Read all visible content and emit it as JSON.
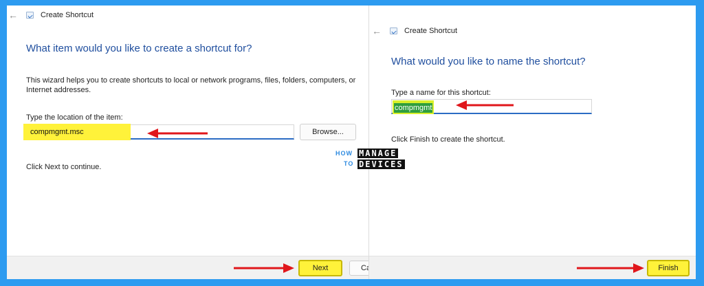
{
  "left_wizard": {
    "title": "Create Shortcut",
    "heading": "What item would you like to create a shortcut for?",
    "description": "This wizard helps you to create shortcuts to local or network programs, files, folders, computers, or Internet addresses.",
    "location_label": "Type the location of the item:",
    "location_value": "compmgmt.msc",
    "browse_label": "Browse...",
    "continue_text": "Click Next to continue.",
    "next_label": "Next",
    "cancel_label": "Ca"
  },
  "right_wizard": {
    "title": "Create Shortcut",
    "heading": "What would you like to name the shortcut?",
    "name_label": "Type a name for this shortcut:",
    "name_value": "compmgmt",
    "finish_text": "Click Finish to create the shortcut.",
    "finish_label": "Finish"
  },
  "logo": {
    "how": "HOW",
    "to": "TO",
    "manage": "MANAGE",
    "devices": "DEVICES"
  },
  "icons": {
    "back": "back-arrow-icon",
    "app": "shortcut-app-icon",
    "annotation": "red-arrow-icon"
  },
  "colors": {
    "background": "#2d9bf0",
    "heading": "#1f4e9e",
    "highlight": "#fff23a",
    "selection": "#2f9e3e",
    "annotation": "#e0161b",
    "input_underline": "#2b6cc4"
  }
}
